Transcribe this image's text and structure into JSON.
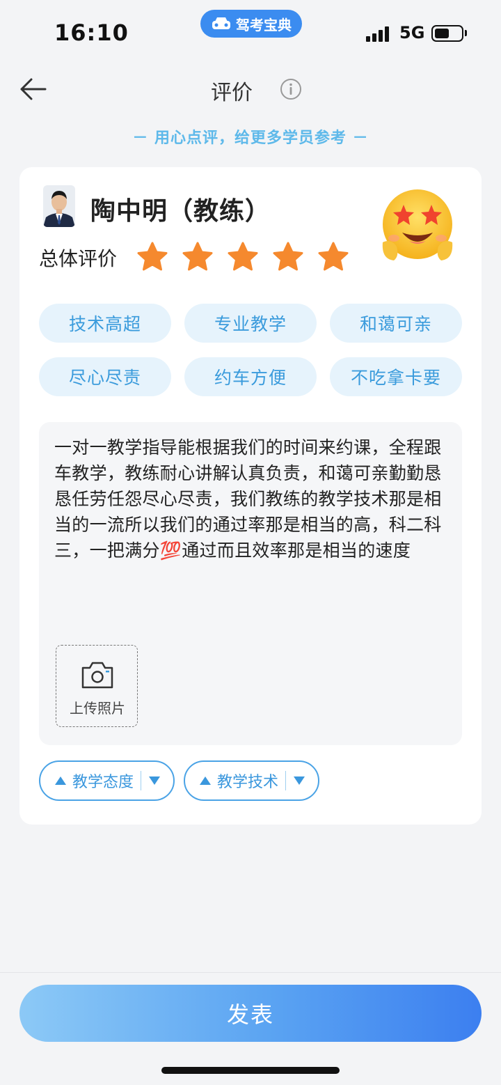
{
  "status_bar": {
    "time": "16:10",
    "app_badge": "驾考宝典",
    "network": "5G"
  },
  "header": {
    "title": "评价"
  },
  "slogan": "－ 用心点评，给更多学员参考 －",
  "coach": {
    "name": "陶中明（教练）"
  },
  "rating": {
    "label": "总体评价",
    "stars": 5,
    "max_stars": 5,
    "star_color": "#f5892e"
  },
  "tags": [
    "技术高超",
    "专业教学",
    "和蔼可亲",
    "尽心尽责",
    "约车方便",
    "不吃拿卡要"
  ],
  "review": {
    "text": "一对一教学指导能根据我们的时间来约课，全程跟车教学，教练耐心讲解认真负责，和蔼可亲勤勤恳恳任劳任怨尽心尽责，我们教练的教学技术那是相当的一流所以我们的通过率那是相当的高，科二科三，一把满分💯通过而且效率那是相当的速度",
    "upload_label": "上传照片"
  },
  "aspects": [
    {
      "label": "教学态度"
    },
    {
      "label": "教学技术"
    }
  ],
  "publish_label": "发表",
  "colors": {
    "accent": "#3a97dd",
    "tag_bg": "#e6f3fc",
    "button_gradient_start": "#8cc9f6",
    "button_gradient_end": "#3c7ff0"
  }
}
